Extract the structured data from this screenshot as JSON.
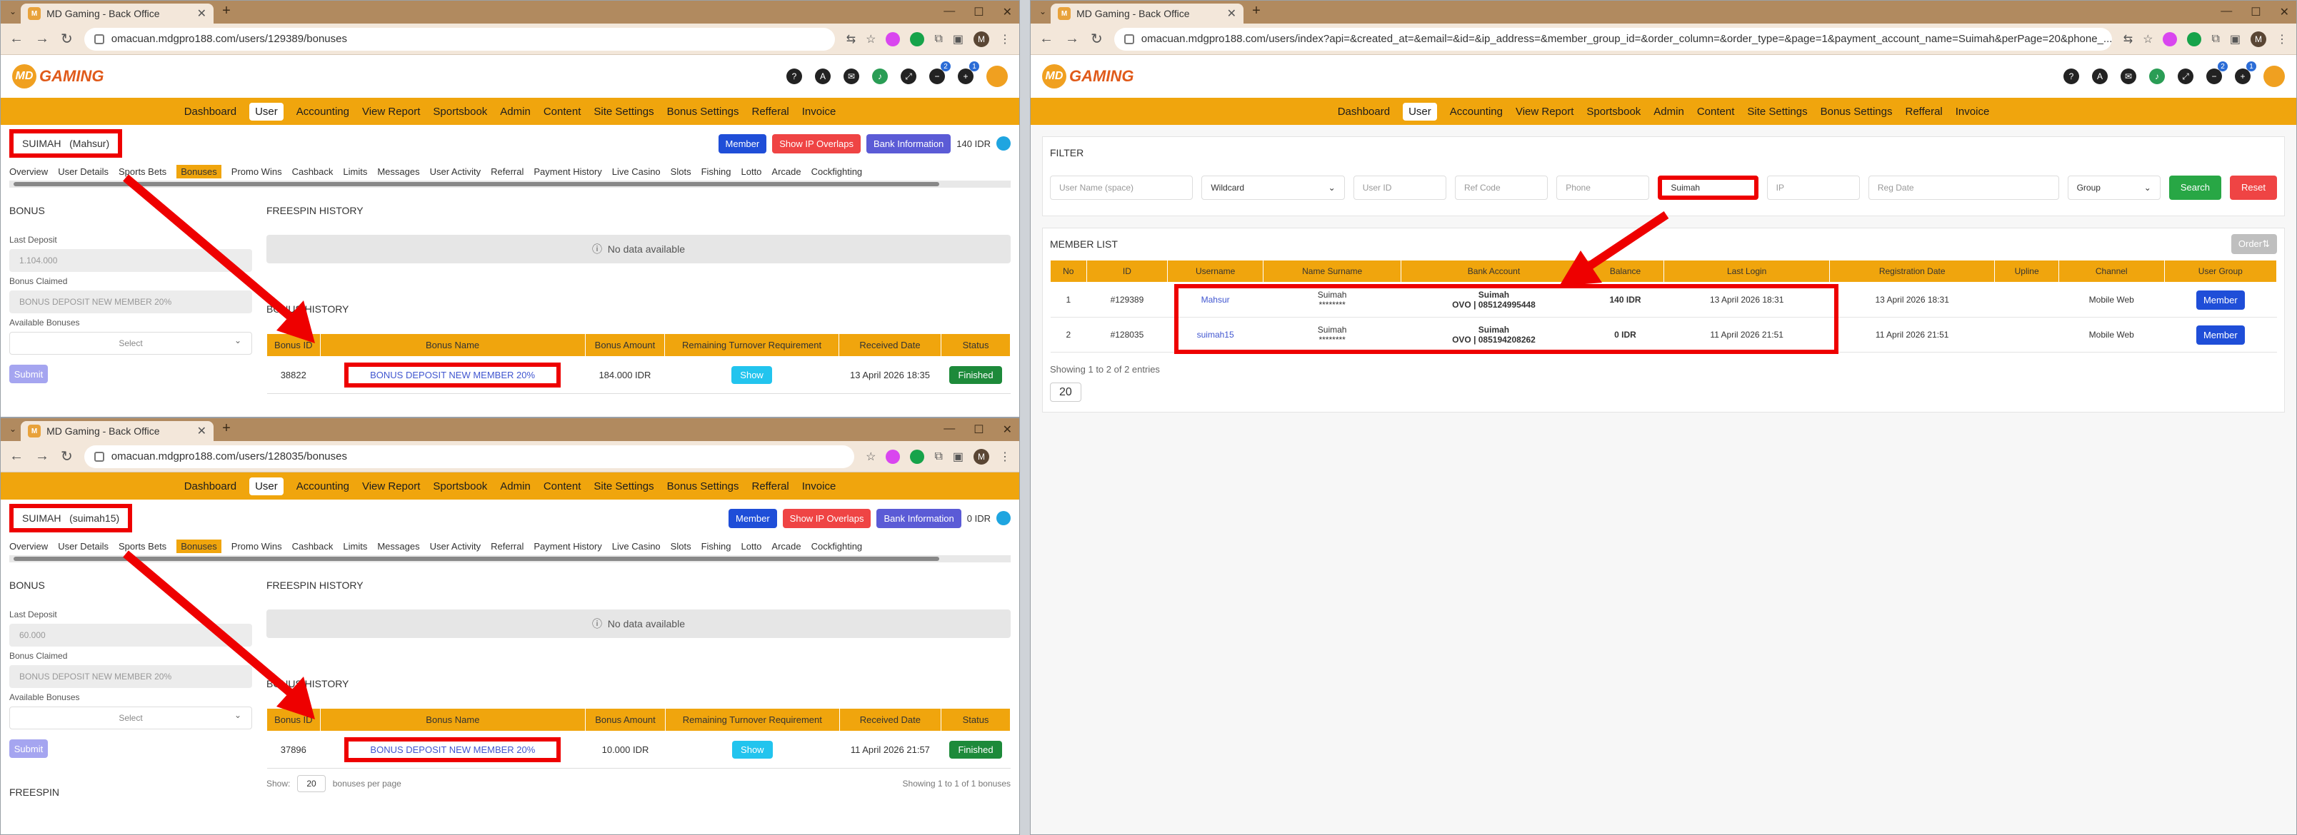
{
  "windows": [
    {
      "tab_title": "MD Gaming - Back Office",
      "url": "omacuan.mdgpro188.com/users/129389/bonuses",
      "username": "SUIMAH",
      "nickname": "(Mahsur)",
      "balance": "140 IDR",
      "last_deposit": "1.104.000",
      "bonus_claimed": "BONUS DEPOSIT NEW MEMBER 20%",
      "row": {
        "id": "38822",
        "name": "BONUS DEPOSIT NEW MEMBER 20%",
        "amount": "184.000 IDR",
        "turnover": "Show",
        "received": "13 April 2026 18:35",
        "status": "Finished"
      }
    },
    {
      "tab_title": "MD Gaming - Back Office",
      "url": "omacuan.mdgpro188.com/users/128035/bonuses",
      "username": "SUIMAH",
      "nickname": "(suimah15)",
      "balance": "0 IDR",
      "last_deposit": "60.000",
      "bonus_claimed": "BONUS DEPOSIT NEW MEMBER 20%",
      "row": {
        "id": "37896",
        "name": "BONUS DEPOSIT NEW MEMBER 20%",
        "amount": "10.000 IDR",
        "turnover": "Show",
        "received": "11 April 2026 21:57",
        "status": "Finished"
      }
    }
  ],
  "menu": [
    "Dashboard",
    "User",
    "Accounting",
    "View Report",
    "Sportsbook",
    "Admin",
    "Content",
    "Site Settings",
    "Bonus Settings",
    "Refferal",
    "Invoice"
  ],
  "logo_text": "GAMING",
  "user_buttons": {
    "member": "Member",
    "ip": "Show IP Overlaps",
    "bank": "Bank Information"
  },
  "subtabs": [
    "Overview",
    "User Details",
    "Sports Bets",
    "Bonuses",
    "Promo Wins",
    "Cashback",
    "Limits",
    "Messages",
    "User Activity",
    "Referral",
    "Payment History",
    "Live Casino",
    "Slots",
    "Fishing",
    "Lotto",
    "Arcade",
    "Cockfighting"
  ],
  "bonus_panel": {
    "title": "BONUS",
    "last_deposit_label": "Last Deposit",
    "bonus_claimed_label": "Bonus Claimed",
    "available_label": "Available Bonuses",
    "select": "Select",
    "submit": "Submit"
  },
  "freespin_title": "FREESPIN HISTORY",
  "no_data": "No data available",
  "bonus_history_title": "BONUS HISTORY",
  "bonus_headers": [
    "Bonus ID",
    "Bonus Name",
    "Bonus Amount",
    "Remaining Turnover Requirement",
    "Received Date",
    "Status"
  ],
  "footer": {
    "show": "Show:",
    "per_page": "20",
    "suffix": "bonuses per page",
    "showing": "Showing 1 to 1 of 1 bonuses"
  },
  "freespin_bottom": "FREESPIN",
  "w3": {
    "tab_title": "MD Gaming - Back Office",
    "url": "omacuan.mdgpro188.com/users/index?api=&created_at=&email=&id=&ip_address=&member_group_id=&order_column=&order_type=&page=1&payment_account_name=Suimah&perPage=20&phone_...",
    "filter_title": "FILTER",
    "filters": {
      "username": "User Name (space)",
      "wildcard": "Wildcard",
      "userid": "User ID",
      "ref": "Ref Code",
      "phone": "Phone",
      "bank": "Suimah",
      "ip": "IP",
      "reg": "Reg Date",
      "group": "Group",
      "search": "Search",
      "reset": "Reset"
    },
    "member_list": "MEMBER LIST",
    "order": "Order⇅",
    "headers": [
      "No",
      "ID",
      "Username",
      "Name Surname",
      "Bank Account",
      "Balance",
      "Last Login",
      "Registration Date",
      "Upline",
      "Channel",
      "User Group"
    ],
    "rows": [
      {
        "no": "1",
        "id": "#129389",
        "username": "Mahsur",
        "name": "Suimah",
        "masked": "********",
        "bank_name": "Suimah",
        "bank_acc": "OVO | 085124995448",
        "balance": "140 IDR",
        "last_login": "13 April 2026 18:31",
        "reg": "13 April 2026 18:31",
        "upline": "",
        "channel": "Mobile Web",
        "group": "Member"
      },
      {
        "no": "2",
        "id": "#128035",
        "username": "suimah15",
        "name": "Suimah",
        "masked": "********",
        "bank_name": "Suimah",
        "bank_acc": "OVO | 085194208262",
        "balance": "0 IDR",
        "last_login": "11 April 2026 21:51",
        "reg": "11 April 2026 21:51",
        "upline": "",
        "channel": "Mobile Web",
        "group": "Member"
      }
    ],
    "showing": "Showing 1 to 2 of 2 entries",
    "per_page": "20"
  },
  "colors": {
    "menu": "#f0a50d",
    "highlight": "#e00000",
    "chrome": "#b18a5f"
  }
}
